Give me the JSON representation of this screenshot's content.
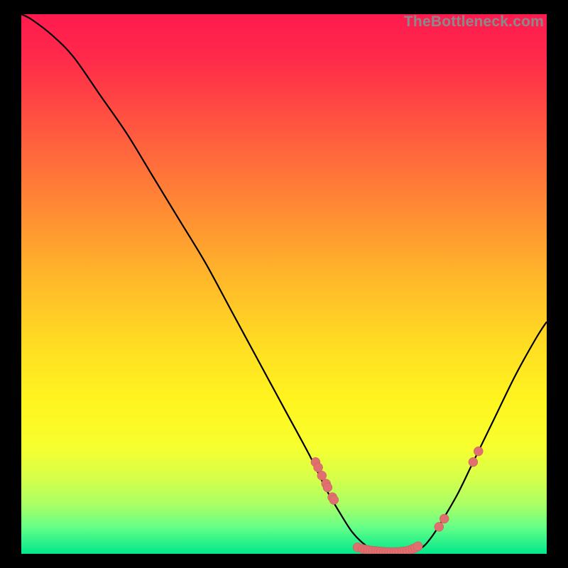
{
  "watermark": "TheBottleneck.com",
  "colors": {
    "background": "#000000",
    "gradient_stops": [
      {
        "offset": 0.0,
        "color": "#ff1a4f"
      },
      {
        "offset": 0.08,
        "color": "#ff2a4a"
      },
      {
        "offset": 0.22,
        "color": "#ff5a3f"
      },
      {
        "offset": 0.36,
        "color": "#ff8a34"
      },
      {
        "offset": 0.5,
        "color": "#ffbb29"
      },
      {
        "offset": 0.62,
        "color": "#ffdf22"
      },
      {
        "offset": 0.72,
        "color": "#fff51f"
      },
      {
        "offset": 0.8,
        "color": "#f7ff2e"
      },
      {
        "offset": 0.86,
        "color": "#d6ff4a"
      },
      {
        "offset": 0.91,
        "color": "#a8ff66"
      },
      {
        "offset": 0.95,
        "color": "#66ff88"
      },
      {
        "offset": 1.0,
        "color": "#00e88a"
      }
    ],
    "curve": "#000000",
    "marker_fill": "#e07070",
    "marker_stroke": "#c85858"
  },
  "chart_data": {
    "type": "line",
    "title": "",
    "xlabel": "",
    "ylabel": "",
    "xlim": [
      0,
      100
    ],
    "ylim": [
      0,
      100
    ],
    "curve": [
      {
        "x": 0,
        "y": 100
      },
      {
        "x": 2,
        "y": 99
      },
      {
        "x": 6,
        "y": 96
      },
      {
        "x": 10,
        "y": 92
      },
      {
        "x": 15,
        "y": 85
      },
      {
        "x": 20,
        "y": 78
      },
      {
        "x": 25,
        "y": 70
      },
      {
        "x": 30,
        "y": 62
      },
      {
        "x": 35,
        "y": 54
      },
      {
        "x": 40,
        "y": 45
      },
      {
        "x": 45,
        "y": 36
      },
      {
        "x": 50,
        "y": 27
      },
      {
        "x": 55,
        "y": 18
      },
      {
        "x": 58,
        "y": 12
      },
      {
        "x": 61,
        "y": 7
      },
      {
        "x": 63,
        "y": 4
      },
      {
        "x": 65,
        "y": 2
      },
      {
        "x": 67,
        "y": 0.8
      },
      {
        "x": 70,
        "y": 0.3
      },
      {
        "x": 73,
        "y": 0.3
      },
      {
        "x": 76,
        "y": 1
      },
      {
        "x": 78,
        "y": 3
      },
      {
        "x": 80,
        "y": 6
      },
      {
        "x": 83,
        "y": 11
      },
      {
        "x": 86,
        "y": 17
      },
      {
        "x": 90,
        "y": 25
      },
      {
        "x": 94,
        "y": 33
      },
      {
        "x": 98,
        "y": 40
      },
      {
        "x": 100,
        "y": 43
      }
    ],
    "markers": [
      {
        "x": 56.0,
        "y": 17.0
      },
      {
        "x": 56.5,
        "y": 16.0
      },
      {
        "x": 57.2,
        "y": 14.5
      },
      {
        "x": 58.0,
        "y": 13.0
      },
      {
        "x": 58.3,
        "y": 12.3
      },
      {
        "x": 59.2,
        "y": 10.5
      },
      {
        "x": 59.5,
        "y": 10.0
      },
      {
        "x": 64.0,
        "y": 1.2
      },
      {
        "x": 65.0,
        "y": 0.9
      },
      {
        "x": 65.5,
        "y": 0.8
      },
      {
        "x": 66.0,
        "y": 0.7
      },
      {
        "x": 66.5,
        "y": 0.6
      },
      {
        "x": 67.0,
        "y": 0.55
      },
      {
        "x": 67.5,
        "y": 0.5
      },
      {
        "x": 68.0,
        "y": 0.45
      },
      {
        "x": 68.5,
        "y": 0.4
      },
      {
        "x": 69.0,
        "y": 0.35
      },
      {
        "x": 69.5,
        "y": 0.32
      },
      {
        "x": 70.0,
        "y": 0.3
      },
      {
        "x": 70.5,
        "y": 0.3
      },
      {
        "x": 71.0,
        "y": 0.3
      },
      {
        "x": 71.5,
        "y": 0.32
      },
      {
        "x": 72.0,
        "y": 0.35
      },
      {
        "x": 72.5,
        "y": 0.4
      },
      {
        "x": 73.0,
        "y": 0.45
      },
      {
        "x": 73.5,
        "y": 0.55
      },
      {
        "x": 74.0,
        "y": 0.7
      },
      {
        "x": 74.5,
        "y": 0.9
      },
      {
        "x": 75.0,
        "y": 1.1
      },
      {
        "x": 75.5,
        "y": 1.4
      },
      {
        "x": 79.5,
        "y": 5.0
      },
      {
        "x": 80.5,
        "y": 6.5
      },
      {
        "x": 86.0,
        "y": 17.0
      },
      {
        "x": 87.0,
        "y": 19.0
      }
    ]
  }
}
